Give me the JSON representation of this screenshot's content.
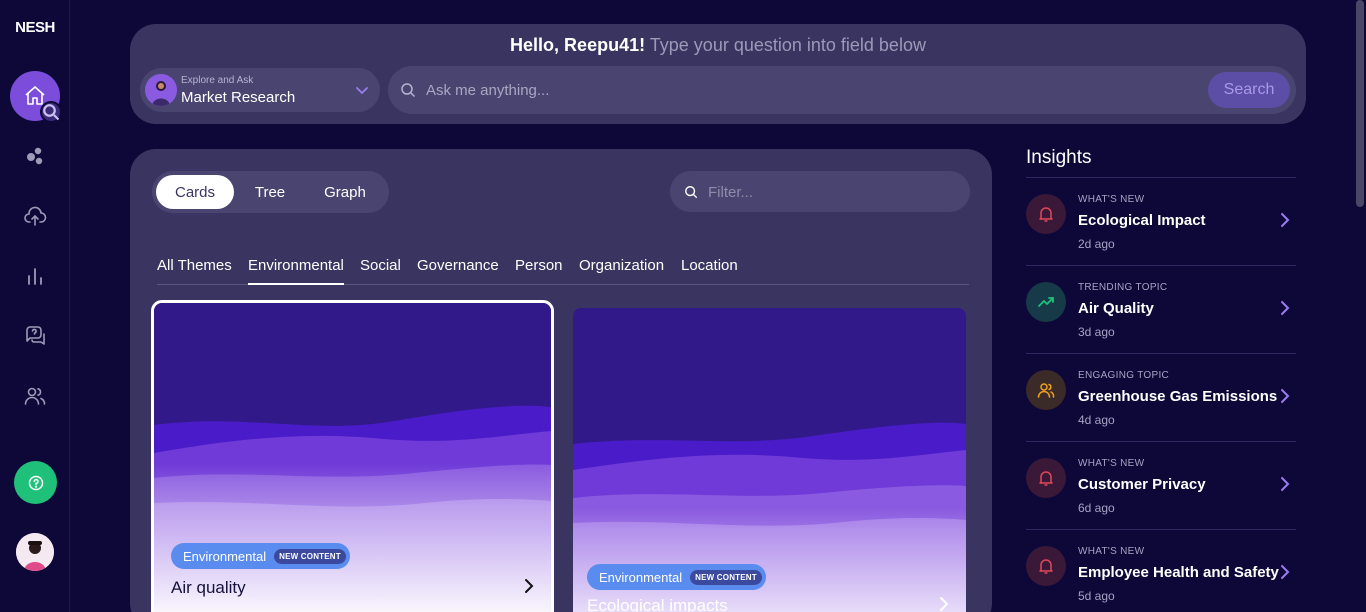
{
  "app": {
    "logo": "NESH"
  },
  "sidebar": {
    "items": [
      {
        "name": "home",
        "icon": "home-icon"
      },
      {
        "name": "themes",
        "icon": "bubbles-icon"
      },
      {
        "name": "upload",
        "icon": "cloud-upload-icon"
      },
      {
        "name": "analytics",
        "icon": "bar-chart-icon"
      },
      {
        "name": "questions",
        "icon": "question-chat-icon"
      },
      {
        "name": "people",
        "icon": "users-icon"
      }
    ],
    "help_icon": "help-circle-icon"
  },
  "ask": {
    "greeting_name": "Hello, Reepu41!",
    "greeting_sub": "Type your question into field below",
    "mode_small": "Explore and Ask",
    "mode_big": "Market Research",
    "input_placeholder": "Ask me anything...",
    "search_label": "Search"
  },
  "main": {
    "views": [
      "Cards",
      "Tree",
      "Graph"
    ],
    "active_view": "Cards",
    "filter_placeholder": "Filter...",
    "themes": [
      "All Themes",
      "Environmental",
      "Social",
      "Governance",
      "Person",
      "Organization",
      "Location"
    ],
    "active_theme": "Environmental",
    "cards": [
      {
        "tag": "Environmental",
        "badge": "NEW CONTENT",
        "title": "Air quality"
      },
      {
        "tag": "Environmental",
        "badge": "NEW CONTENT",
        "title": "Ecological impacts"
      }
    ]
  },
  "insights": {
    "title": "Insights",
    "items": [
      {
        "label": "WHAT'S NEW",
        "title": "Ecological Impact",
        "time": "2d ago",
        "icon": "bell-icon",
        "color": "#e0485a"
      },
      {
        "label": "TRENDING TOPIC",
        "title": "Air Quality",
        "time": "3d ago",
        "icon": "trending-up-icon",
        "color": "#1fc07a"
      },
      {
        "label": "ENGAGING TOPIC",
        "title": "Greenhouse Gas Emissions",
        "time": "4d ago",
        "icon": "users-icon",
        "color": "#f0a020"
      },
      {
        "label": "WHAT'S NEW",
        "title": "Customer Privacy",
        "time": "6d ago",
        "icon": "bell-icon",
        "color": "#e0485a"
      },
      {
        "label": "WHAT'S NEW",
        "title": "Employee Health and Safety",
        "time": "5d ago",
        "icon": "bell-icon",
        "color": "#e0485a"
      }
    ]
  },
  "colors": {
    "accent": "#7c4ddb",
    "background": "#0d0838",
    "panel": "#3a3560",
    "green": "#1fc07a"
  }
}
